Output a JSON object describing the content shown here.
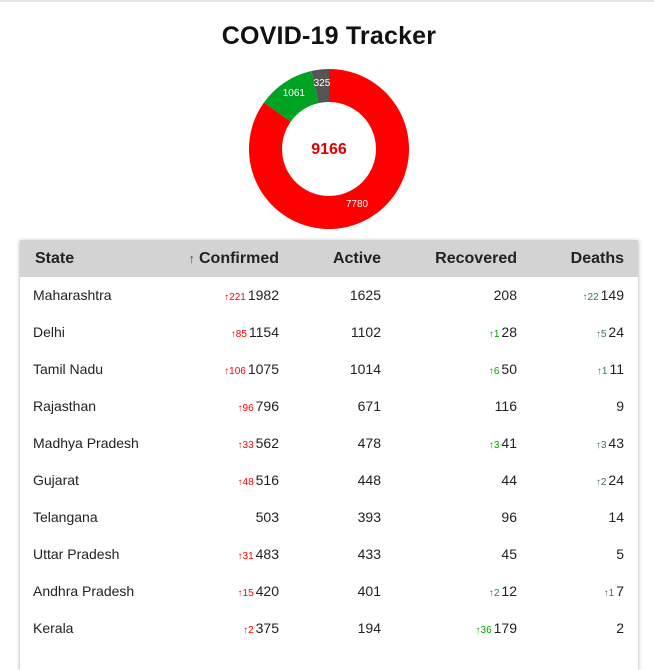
{
  "header": {
    "title": "COVID-19 Tracker"
  },
  "chart_data": {
    "type": "pie",
    "center_label": "9166",
    "slices": [
      {
        "label": "7780",
        "value": 7780,
        "color": "#ff0000"
      },
      {
        "label": "1061",
        "value": 1061,
        "color": "#00a321"
      },
      {
        "label": "325",
        "value": 325,
        "color": "#555555"
      }
    ]
  },
  "table": {
    "columns": [
      {
        "key": "state",
        "label": "State"
      },
      {
        "key": "confirmed",
        "label": "Confirmed",
        "sort_icon": "↑"
      },
      {
        "key": "active",
        "label": "Active"
      },
      {
        "key": "recovered",
        "label": "Recovered"
      },
      {
        "key": "deaths",
        "label": "Deaths"
      }
    ],
    "rows": [
      {
        "state": "Maharashtra",
        "confirmed": "1982",
        "confirmed_delta": "221",
        "active": "1625",
        "recovered": "208",
        "recovered_delta": "",
        "deaths": "149",
        "deaths_delta": "22"
      },
      {
        "state": "Delhi",
        "confirmed": "1154",
        "confirmed_delta": "85",
        "active": "1102",
        "recovered": "28",
        "recovered_delta": "1",
        "deaths": "24",
        "deaths_delta": "5"
      },
      {
        "state": "Tamil Nadu",
        "confirmed": "1075",
        "confirmed_delta": "106",
        "active": "1014",
        "recovered": "50",
        "recovered_delta": "6",
        "deaths": "11",
        "deaths_delta": "1"
      },
      {
        "state": "Rajasthan",
        "confirmed": "796",
        "confirmed_delta": "96",
        "active": "671",
        "recovered": "116",
        "recovered_delta": "",
        "deaths": "9",
        "deaths_delta": ""
      },
      {
        "state": "Madhya Pradesh",
        "confirmed": "562",
        "confirmed_delta": "33",
        "active": "478",
        "recovered": "41",
        "recovered_delta": "3",
        "deaths": "43",
        "deaths_delta": "3"
      },
      {
        "state": "Gujarat",
        "confirmed": "516",
        "confirmed_delta": "48",
        "active": "448",
        "recovered": "44",
        "recovered_delta": "",
        "deaths": "24",
        "deaths_delta": "2"
      },
      {
        "state": "Telangana",
        "confirmed": "503",
        "confirmed_delta": "",
        "active": "393",
        "recovered": "96",
        "recovered_delta": "",
        "deaths": "14",
        "deaths_delta": ""
      },
      {
        "state": "Uttar Pradesh",
        "confirmed": "483",
        "confirmed_delta": "31",
        "active": "433",
        "recovered": "45",
        "recovered_delta": "",
        "deaths": "5",
        "deaths_delta": ""
      },
      {
        "state": "Andhra Pradesh",
        "confirmed": "420",
        "confirmed_delta": "15",
        "active": "401",
        "recovered": "12",
        "recovered_delta": "2",
        "deaths": "7",
        "deaths_delta": "1"
      },
      {
        "state": "Kerala",
        "confirmed": "375",
        "confirmed_delta": "2",
        "active": "194",
        "recovered": "179",
        "recovered_delta": "36",
        "deaths": "2",
        "deaths_delta": ""
      }
    ]
  }
}
